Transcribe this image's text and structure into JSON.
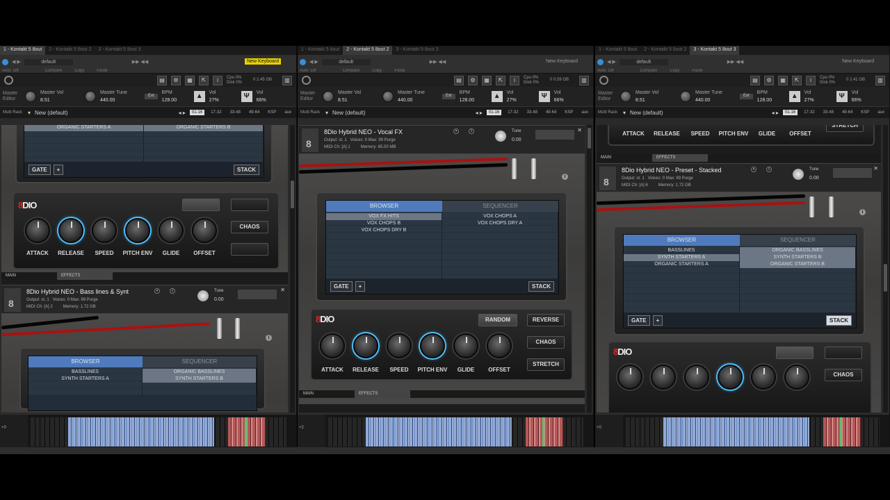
{
  "windows": [
    {
      "tabs": [
        "1 - Kontakt 5 8out",
        "2 - Kontakt 5 8out 2",
        "3 - Kontakt 5 8out 3"
      ],
      "active_tab": 0,
      "toolbar": {
        "preset": "default",
        "auto": "Auto: Off",
        "compare": "Compare",
        "copy": "Copy",
        "paste": "Paste",
        "keyboard": "New Keyboard",
        "keyboard_highlight": true
      },
      "cpu": "Cpu 0% Disk 0%",
      "disk": "0 2.45 GB",
      "master": {
        "label": "Master Editor",
        "vol_label": "Master Vol",
        "vol": "8.51",
        "tune_label": "Master Tune",
        "tune": "440.00",
        "ext": "Ext",
        "bpm_label": "BPM",
        "bpm": "128.00",
        "vol2_label": "Vol",
        "vol2": "27%",
        "vol3_label": "Vol",
        "vol3": "66%"
      },
      "multi": {
        "label": "Multi Rack",
        "name": "New (default)",
        "slots": [
          "01-16",
          "17-32",
          "33-48",
          "49-64",
          "KSP",
          "aux"
        ]
      },
      "top_panel": {
        "cols": [
          [
            "ORGANIC STARTERS A"
          ],
          [
            "ORGANIC STARTERS B"
          ]
        ],
        "gate": "GATE",
        "plus": "+",
        "stack": "STACK"
      },
      "controls": {
        "knobs": [
          "ATTACK",
          "RELEASE",
          "SPEED",
          "PITCH ENV",
          "GLIDE",
          "OFFSET"
        ],
        "buttons": [
          "CHAOS"
        ]
      },
      "main_effects": [
        "MAIN",
        "EFFECTS"
      ],
      "instrument": {
        "name": "8Dio Hybrid NEO - Bass lines & Synt",
        "output": "Output: st. 1",
        "voices": "Voices: 0",
        "max": "Max: 99",
        "purge": "Purge",
        "midi": "MIDI Ch: [A] 2",
        "memory": "Memory: 1.72 GB",
        "tune_label": "Tune",
        "tune": "0.00"
      },
      "bottom_panel": {
        "tabs": [
          "BROWSER",
          "SEQUENCER"
        ],
        "cols": [
          [
            "BASSLINES",
            "SYNTH STARTERS A"
          ],
          [
            "ORGANIC BASSLINES",
            "SYNTH STARTERS B"
          ]
        ]
      },
      "keyboard_offset": "+0"
    },
    {
      "tabs": [
        "1 - Kontakt 5 8out",
        "2 - Kontakt 5 8out 2",
        "3 - Kontakt 5 8out 3"
      ],
      "active_tab": 1,
      "toolbar": {
        "preset": "default",
        "auto": "Auto: Off",
        "compare": "Compare",
        "copy": "Copy",
        "paste": "Paste",
        "keyboard": "New Keyboard",
        "keyboard_highlight": false
      },
      "cpu": "Cpu 0% Disk 0%",
      "disk": "0 0.59 GB",
      "master": {
        "label": "Master Editor",
        "vol_label": "Master Vol",
        "vol": "8.51",
        "tune_label": "Master Tune",
        "tune": "440.00",
        "ext": "Ext",
        "bpm_label": "BPM",
        "bpm": "128.00",
        "vol2_label": "Vol",
        "vol2": "27%",
        "vol3_label": "Vol",
        "vol3": "66%"
      },
      "multi": {
        "label": "Multi Rack",
        "name": "New (default)",
        "slots": [
          "01-16",
          "17-32",
          "33-48",
          "49-64",
          "KSP",
          "aux"
        ]
      },
      "instrument": {
        "name": "8Dio Hybrid NEO - Vocal FX",
        "output": "Output: st. 1",
        "voices": "Voices: 0",
        "max": "Max: 99",
        "purge": "Purge",
        "midi": "MIDI Ch: [A] 1",
        "memory": "Memory: 65.00 MB",
        "tune_label": "Tune",
        "tune": "0.00"
      },
      "panel": {
        "tabs": [
          "BROWSER",
          "SEQUENCER"
        ],
        "cols": [
          [
            "VOX FX HITS",
            "VOX CHOPS B",
            "VOX CHOPS DRY B"
          ],
          [
            "VOX CHOPS A",
            "VOX CHOPS DRY A"
          ]
        ],
        "gate": "GATE",
        "plus": "+",
        "stack": "STACK"
      },
      "controls": {
        "knobs": [
          "ATTACK",
          "RELEASE",
          "SPEED",
          "PITCH ENV",
          "GLIDE",
          "OFFSET"
        ],
        "buttons": [
          "RANDOM",
          "REVERSE",
          "CHAOS",
          "STRETCH"
        ]
      },
      "main_effects": [
        "MAIN",
        "EFFECTS"
      ],
      "keyboard_offset": "+2"
    },
    {
      "tabs": [
        "1 - Kontakt 5 8out",
        "2 - Kontakt 5 8out 2",
        "3 - Kontakt 5 8out 3"
      ],
      "active_tab": 2,
      "toolbar": {
        "preset": "default",
        "auto": "Auto: Off",
        "compare": "Compare",
        "copy": "Copy",
        "paste": "Paste",
        "keyboard": "New Keyboard",
        "keyboard_highlight": false
      },
      "cpu": "Cpu 0% Disk 0%",
      "disk": "0 2.41 GB",
      "master": {
        "label": "Master Editor",
        "vol_label": "Master Vol",
        "vol": "8.51",
        "tune_label": "Master Tune",
        "tune": "440.00",
        "ext": "Ext",
        "bpm_label": "BPM",
        "bpm": "128.00",
        "vol2_label": "Vol",
        "vol2": "27%",
        "vol3_label": "Vol",
        "vol3": "66%"
      },
      "multi": {
        "label": "Multi Rack",
        "name": "New (default)",
        "slots": [
          "01-16",
          "17-32",
          "33-48",
          "49-64",
          "KSP",
          "aux"
        ]
      },
      "top_labels": [
        "ATTACK",
        "RELEASE",
        "SPEED",
        "PITCH ENV",
        "GLIDE",
        "OFFSET"
      ],
      "top_stretch": "STRETCH",
      "main_effects": [
        "MAIN",
        "EFFECTS"
      ],
      "instrument": {
        "name": "8Dio Hybrid NEO - Preset - Stacked",
        "output": "Output: st. 1",
        "voices": "Voices: 0",
        "max": "Max: 99",
        "purge": "Purge",
        "midi": "MIDI Ch: [A] 6",
        "memory": "Memory: 1.72 GB",
        "tune_label": "Tune",
        "tune": "0.00"
      },
      "panel": {
        "tabs": [
          "BROWSER",
          "SEQUENCER"
        ],
        "cols": [
          [
            "BASSLINES",
            "SYNTH STARTERS A",
            "ORGANIC STARTERS A"
          ],
          [
            "ORGANIC BASSLINES",
            "SYNTH STARTERS B",
            "ORGANIC STARTERS B"
          ]
        ],
        "gate": "GATE",
        "plus": "+",
        "stack": "STACK"
      },
      "controls": {
        "buttons": [
          "CHAOS"
        ]
      },
      "keyboard_offset": "+0"
    }
  ],
  "colors": {
    "accent": "#4f7bbd",
    "keyboard_highlight": "#e8d200",
    "cable": "#aa1111",
    "brand_red": "#e02525"
  },
  "icons": [
    "power-icon",
    "save-icon",
    "gear-icon",
    "info-icon",
    "close-icon",
    "camera-icon",
    "kontakt-logo-icon"
  ]
}
